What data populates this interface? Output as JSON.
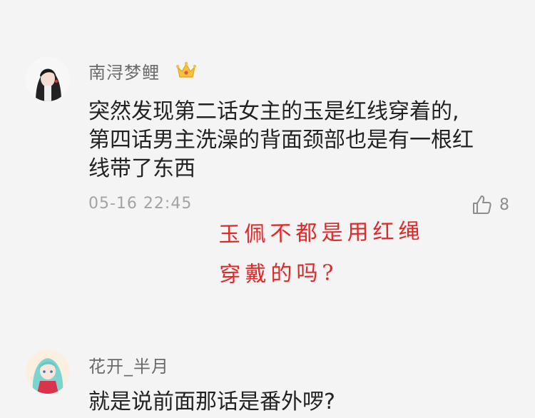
{
  "comments": [
    {
      "username": "南浔梦鲤",
      "badge_icon": "crown-icon",
      "lines": [
        "突然发现第二话女主的玉是红线穿着的,",
        "第四话男主洗澡的背面颈部也是有一根红",
        "线带了东西"
      ],
      "timestamp": "05-16 22:45",
      "like_icon": "thumbs-up-icon",
      "like_count": "8"
    },
    {
      "username": "花开_半月",
      "lines": [
        "就是说前面那话是番外啰?"
      ]
    }
  ],
  "annotation": {
    "lines": [
      "玉佩不都是用红绳",
      "穿戴的吗?"
    ],
    "color": "#e02828"
  }
}
